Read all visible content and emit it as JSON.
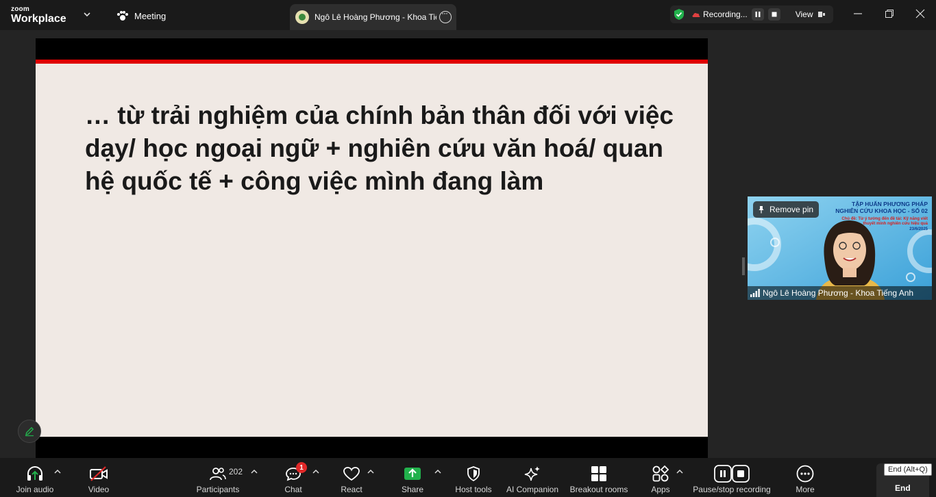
{
  "app": {
    "logo_small": "zoom",
    "logo_big": "Workplace",
    "meeting_tab": "Meeting",
    "active_tab": "Ngô Lê Hoàng Phương - Khoa Tiế",
    "recording_label": "Recording...",
    "view_label": "View"
  },
  "slide": {
    "text": "… từ trải nghiệm của chính bản thân đối với việc dạy/ học ngoại ngữ + nghiên cứu văn hoá/ quan hệ quốc tế + công việc mình đang làm"
  },
  "video": {
    "remove_pin": "Remove pin",
    "title": "TẬP HUẤN PHƯƠNG PHÁP NGHIÊN CỨU KHOA HỌC - SỐ 02",
    "subtitle": "Chủ đề: Từ ý tưởng đến đề tài: Kỹ năng viết thuyết minh nghiên cứu hiệu quả",
    "date": "23/6/2025",
    "participant_name": "Ngô Lê Hoàng Phương - Khoa Tiếng Anh"
  },
  "toolbar": {
    "join_audio": "Join audio",
    "video": "Video",
    "participants": "Participants",
    "participant_count": "202",
    "chat": "Chat",
    "chat_badge": "1",
    "react": "React",
    "share": "Share",
    "host_tools": "Host tools",
    "ai_companion": "AI Companion",
    "breakout_rooms": "Breakout rooms",
    "apps": "Apps",
    "pause_recording": "Pause/stop recording",
    "more": "More",
    "end": "End",
    "end_tooltip": "End (Alt+Q)"
  },
  "colors": {
    "accent_green": "#22b14c",
    "slide_red": "#e00000",
    "badge_red": "#e02828"
  }
}
